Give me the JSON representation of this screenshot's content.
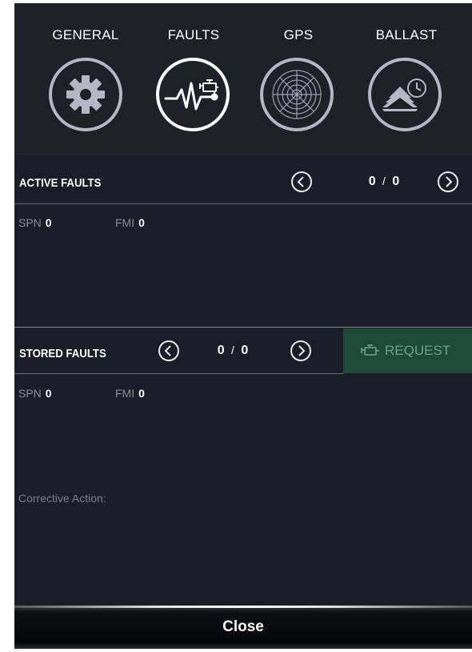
{
  "tabs": [
    {
      "label": "GENERAL",
      "icon": "gear-icon",
      "active": false
    },
    {
      "label": "FAULTS",
      "icon": "engine-fault-icon",
      "active": true
    },
    {
      "label": "GPS",
      "icon": "radar-icon",
      "active": false
    },
    {
      "label": "BALLAST",
      "icon": "ballast-timer-icon",
      "active": false
    }
  ],
  "active_faults": {
    "title": "ACTIVE FAULTS",
    "current": "0",
    "separator": "/",
    "total": "0",
    "spn_label": "SPN",
    "spn_value": "0",
    "fmi_label": "FMI",
    "fmi_value": "0"
  },
  "stored_faults": {
    "title": "STORED FAULTS",
    "current": "0",
    "separator": "/",
    "total": "0",
    "request_label": "REQUEST",
    "spn_label": "SPN",
    "spn_value": "0",
    "fmi_label": "FMI",
    "fmi_value": "0",
    "corrective_label": "Corrective Action:"
  },
  "close_label": "Close",
  "colors": {
    "background": "#1b1d27",
    "request_bg": "#1f4a38",
    "request_text": "#67a589"
  }
}
